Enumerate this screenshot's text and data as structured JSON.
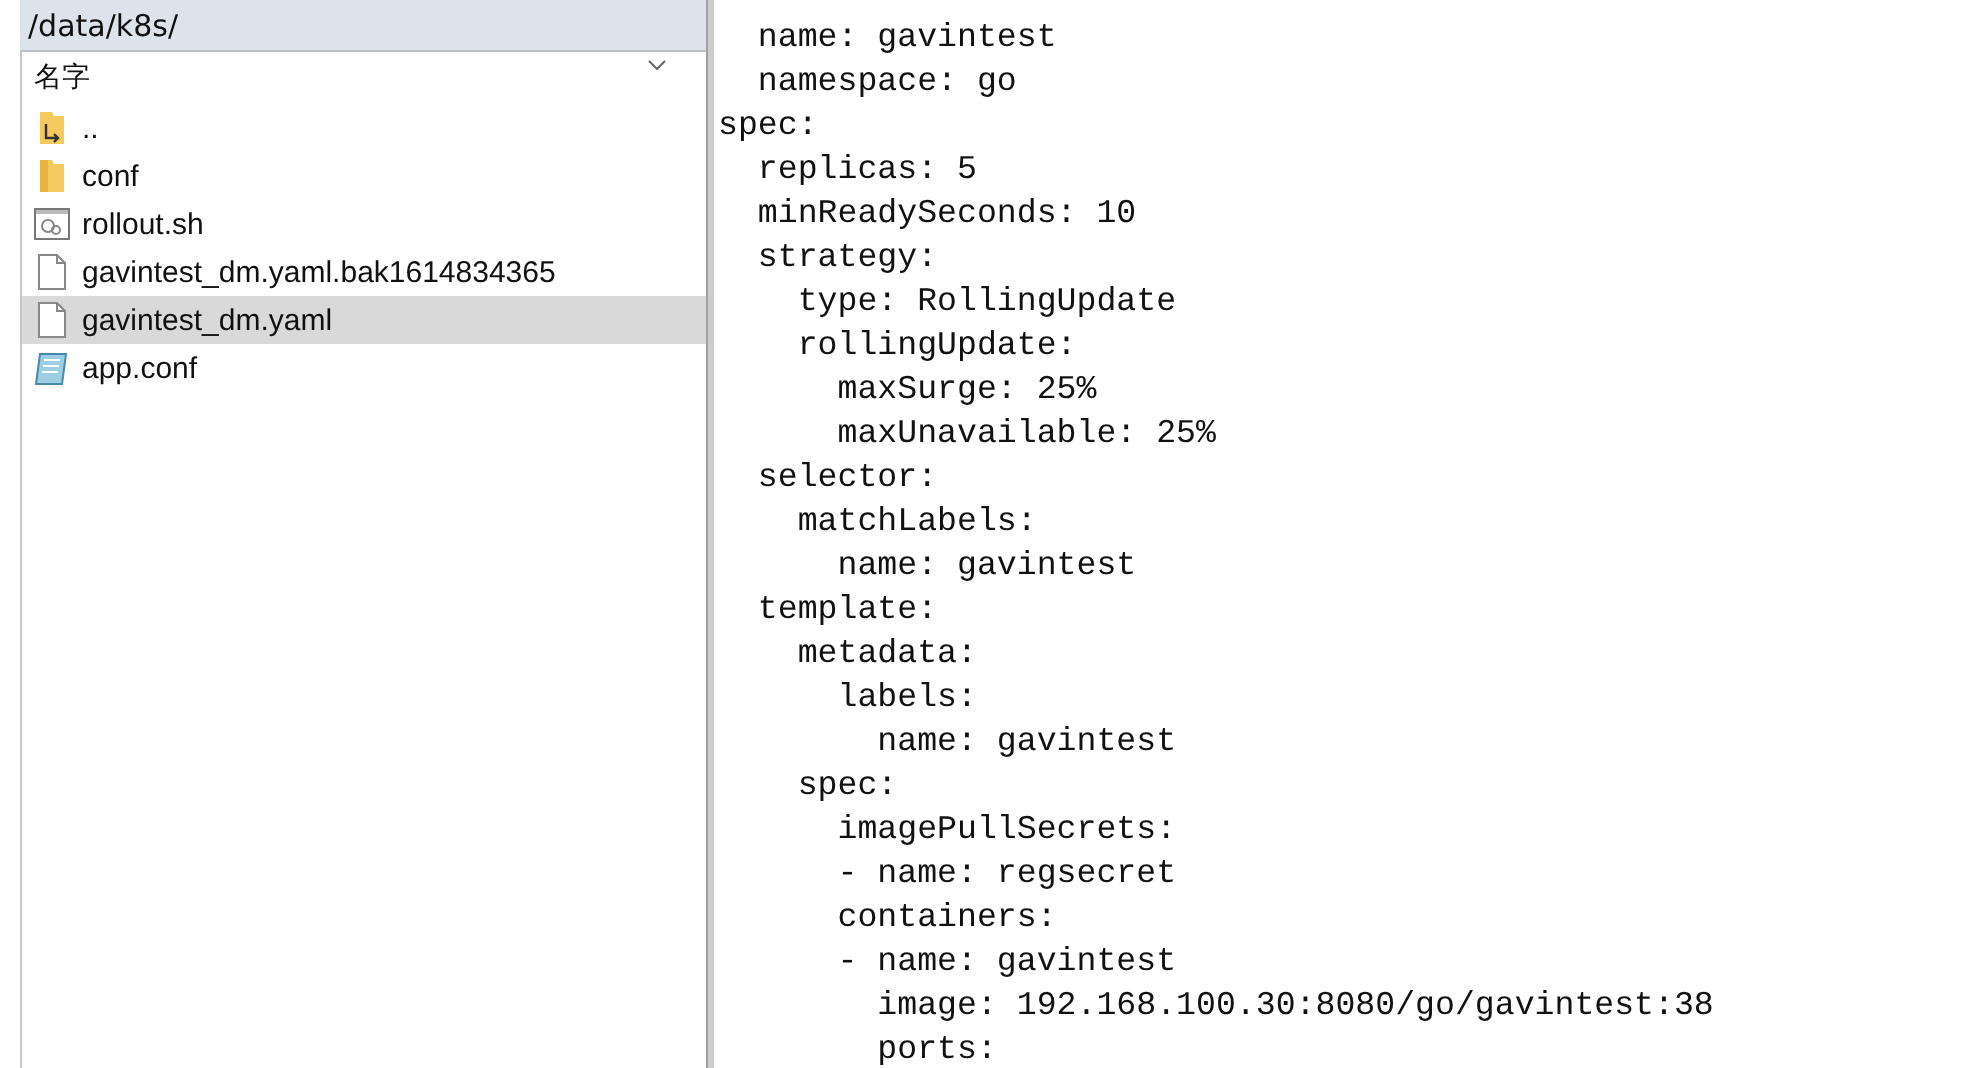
{
  "file_panel": {
    "path": "/data/k8s/",
    "column_header": "名字",
    "files": [
      {
        "name": "..",
        "kind": "parent",
        "selected": false
      },
      {
        "name": "conf",
        "kind": "folder",
        "selected": false
      },
      {
        "name": "rollout.sh",
        "kind": "script",
        "selected": false
      },
      {
        "name": "gavintest_dm.yaml.bak1614834365",
        "kind": "file",
        "selected": false
      },
      {
        "name": "gavintest_dm.yaml",
        "kind": "file",
        "selected": true
      },
      {
        "name": "app.conf",
        "kind": "config",
        "selected": false
      }
    ]
  },
  "editor": {
    "lines": [
      "  name: gavintest",
      "  namespace: go",
      "spec:",
      "  replicas: 5",
      "  minReadySeconds: 10",
      "  strategy:",
      "    type: RollingUpdate",
      "    rollingUpdate:",
      "      maxSurge: 25%",
      "      maxUnavailable: 25%",
      "  selector:",
      "    matchLabels:",
      "      name: gavintest",
      "  template:",
      "    metadata:",
      "      labels:",
      "        name: gavintest",
      "    spec:",
      "      imagePullSecrets:",
      "      - name: regsecret",
      "      containers:",
      "      - name: gavintest",
      "        image: 192.168.100.30:8080/go/gavintest:38",
      "        ports:"
    ]
  }
}
